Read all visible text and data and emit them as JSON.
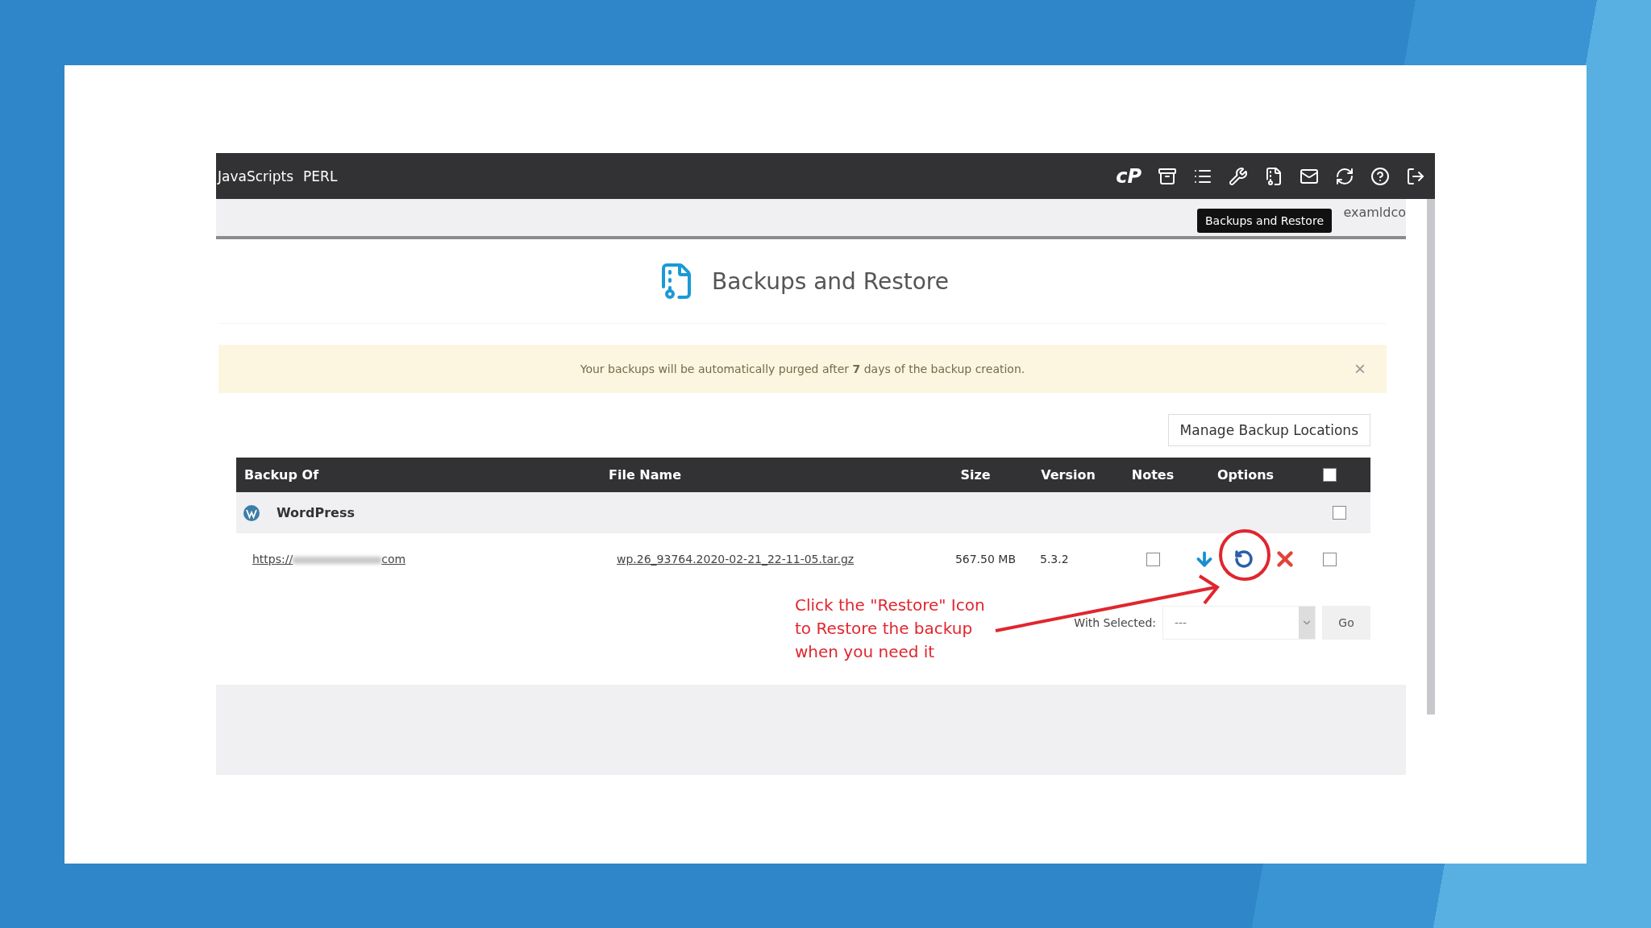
{
  "top_bar": {
    "links": [
      "JavaScripts",
      "PERL"
    ],
    "logo": "cP",
    "tooltip": "Backups and Restore",
    "welcome": "examldco"
  },
  "page": {
    "title": "Backups and Restore"
  },
  "alert": {
    "text": "Your backups will be automatically purged after **7** days of the backup creation.",
    "close": "×"
  },
  "manage_button": "Manage Backup Locations",
  "table": {
    "columns": [
      "Backup Of",
      "File Name",
      "Size",
      "Version",
      "Notes",
      "Options"
    ],
    "select_all": {
      "checked": false
    },
    "group": {
      "name": "WordPress",
      "checked": false
    },
    "rows": [
      {
        "url_prefix": "https://",
        "url_suffix": "com",
        "file": "wp.26_93764.2020-02-21_22-11-05.tar.gz",
        "size": "567.50 MB",
        "version": "5.3.2",
        "notes_checked": false,
        "checked": false
      }
    ]
  },
  "bulk": {
    "label": "With Selected:",
    "value": "---",
    "go": "Go"
  },
  "annotation": {
    "text": "Click the \"Restore\" Icon\nto Restore the backup\nwhen you need it"
  }
}
